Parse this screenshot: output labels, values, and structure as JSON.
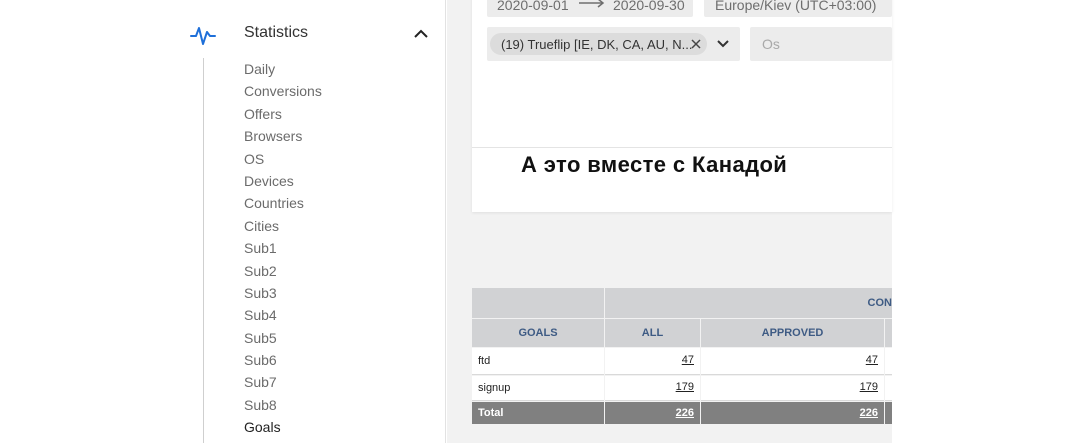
{
  "sidebar": {
    "section_title": "Statistics",
    "items": [
      "Daily",
      "Conversions",
      "Offers",
      "Browsers",
      "OS",
      "Devices",
      "Countries",
      "Cities",
      "Sub1",
      "Sub2",
      "Sub3",
      "Sub4",
      "Sub5",
      "Sub6",
      "Sub7",
      "Sub8",
      "Goals"
    ],
    "active_item": "Goals",
    "icons": {
      "section": "pulse-icon",
      "toggle": "chevron-up-icon"
    },
    "accent_color": "#1e6fd9"
  },
  "filters": {
    "date_from": "2020-09-01",
    "date_to": "2020-09-30",
    "timezone": "Europe/Kiev (UTC+03:00)",
    "offer_chip": "(19) Trueflip [IE, DK, CA, AU, N...",
    "os_placeholder": "Os"
  },
  "annotation": "А это вместе с Канадой",
  "table": {
    "group_header": "CON",
    "columns": [
      "GOALS",
      "ALL",
      "APPROVED"
    ],
    "rows": [
      {
        "goal": "ftd",
        "all": "47",
        "approved": "47"
      },
      {
        "goal": "signup",
        "all": "179",
        "approved": "179"
      }
    ],
    "total": {
      "goal": "Total",
      "all": "226",
      "approved": "226"
    },
    "header_color": "#3e5b84"
  }
}
